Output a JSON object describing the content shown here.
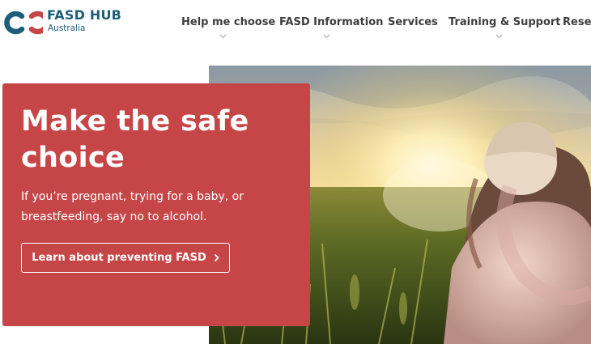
{
  "header": {
    "logo": {
      "title": "FASD HUB",
      "subtitle": "Australia",
      "icon": "linked-rings-logo-icon",
      "colors": {
        "teal": "#1d5f7a",
        "red": "#c64648"
      }
    },
    "nav": [
      {
        "label": "Help me choose",
        "has_dropdown": true
      },
      {
        "label": "FASD Information",
        "has_dropdown": true
      },
      {
        "label": "Services",
        "has_dropdown": false
      },
      {
        "label": "Training & Support",
        "has_dropdown": true
      },
      {
        "label": "Resea",
        "has_dropdown": false
      }
    ]
  },
  "hero": {
    "title": "Make the safe choice",
    "body": "If you’re pregnant, trying for a baby, or breastfeeding, say no to alcohol.",
    "cta_label": "Learn about preventing FASD",
    "cta_icon": "chevron-right-icon",
    "card_color": "#c64648",
    "photo": "sunset-field-mother-child-photo"
  }
}
